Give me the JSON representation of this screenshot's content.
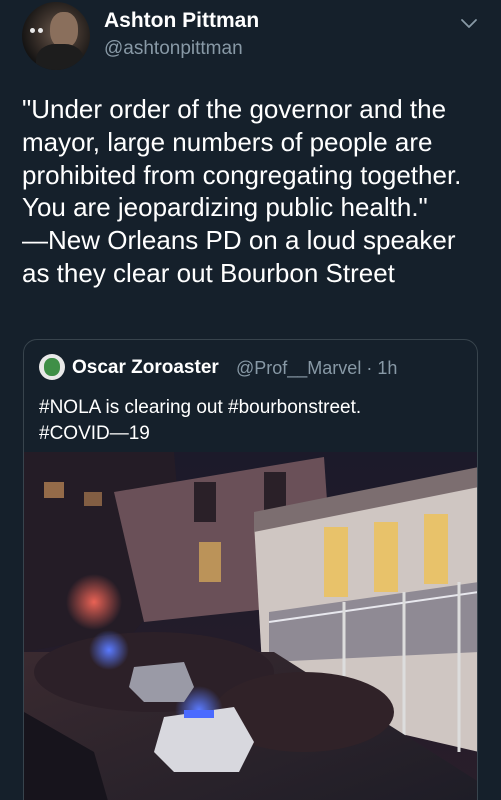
{
  "author": {
    "display_name": "Ashton Pittman",
    "handle": "@ashtonpittman"
  },
  "tweet": {
    "text": "\"Under order of the governor and the\nmayor, large numbers of people are\nprohibited from congregating together.\nYou are jeopardizing public health.\"\n—New Orleans PD on a loud speaker\nas they clear out Bourbon Street"
  },
  "quoted": {
    "display_name": "Oscar Zoroaster",
    "handle": "@Prof__Marvel",
    "separator": "·",
    "time": "1h",
    "text": "#NOLA is clearing out #bourbonstreet.\n#COVID—19"
  },
  "icons": {
    "more": "chevron-down-icon"
  },
  "colors": {
    "background": "#15202b",
    "secondary_text": "#8899a6",
    "border": "#38444d"
  }
}
